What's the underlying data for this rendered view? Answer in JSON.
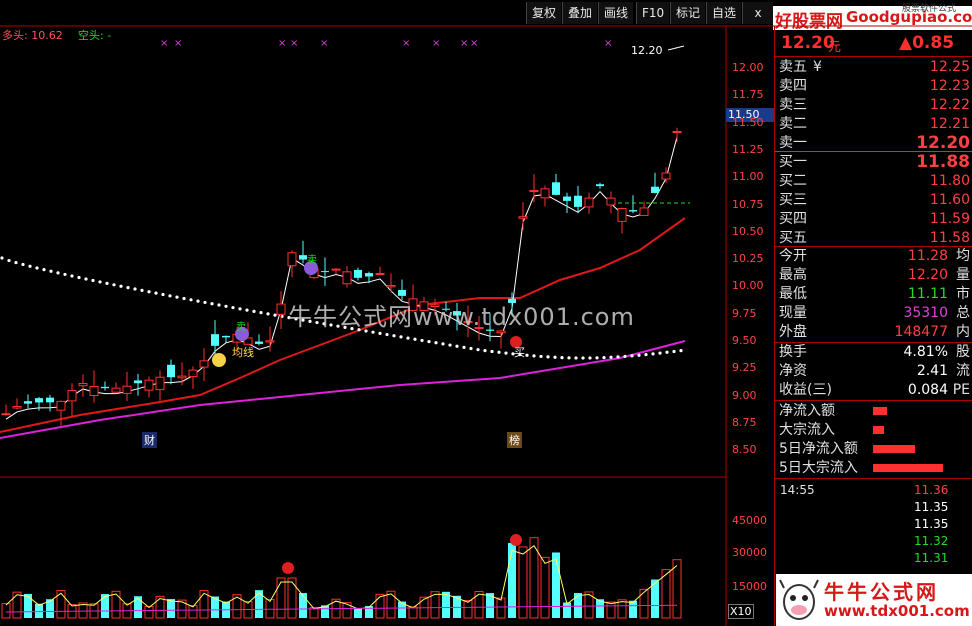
{
  "toolbar": {
    "buttons": [
      "复权",
      "叠加",
      "画线",
      "F10",
      "标记",
      "自选"
    ],
    "close_glyph": "x",
    "watermark_left": "好股票网",
    "watermark_right": "Goodgupiao.com",
    "watermark_small": "股票软件公式"
  },
  "indicator": {
    "bull_label": "多头: 10.62",
    "bear_label": "空头: -"
  },
  "chart": {
    "price_axis": [
      "12.00",
      "11.75",
      "11.50",
      "11.25",
      "11.00",
      "10.75",
      "10.50",
      "10.25",
      "10.00",
      "9.75",
      "9.50",
      "9.25",
      "9.00",
      "8.75",
      "8.50"
    ],
    "current_price_tag": "11.50",
    "high_label": "12.20",
    "watermark": "牛牛公式网www.tdx001.com",
    "mark_cai": "财",
    "mark_bang": "榜",
    "buy_label": "买",
    "sell_label": "卖",
    "sign_label": "卖",
    "chip_label": "均线",
    "volume_axis": [
      "45000",
      "30000",
      "15000"
    ],
    "volume_unit": "X10"
  },
  "quote": {
    "price": "12.20",
    "price_unit": "元",
    "change": "▲0.85",
    "asks": [
      {
        "label": "卖五",
        "value": "12.25",
        "extra": "¥"
      },
      {
        "label": "卖四",
        "value": "12.23"
      },
      {
        "label": "卖三",
        "value": "12.22"
      },
      {
        "label": "卖二",
        "value": "12.21"
      },
      {
        "label": "卖一",
        "value": "12.20"
      }
    ],
    "bids": [
      {
        "label": "买一",
        "value": "11.88"
      },
      {
        "label": "买二",
        "value": "11.80"
      },
      {
        "label": "买三",
        "value": "11.60"
      },
      {
        "label": "买四",
        "value": "11.59"
      },
      {
        "label": "买五",
        "value": "11.58"
      }
    ],
    "stats": [
      {
        "label": "今开",
        "value": "11.28",
        "right": "均"
      },
      {
        "label": "最高",
        "value": "12.20",
        "right": "量"
      },
      {
        "label": "最低",
        "value": "11.11",
        "right": "市"
      },
      {
        "label": "现量",
        "value": "35310",
        "right": "总"
      },
      {
        "label": "外盘",
        "value": "148477",
        "right": "内"
      }
    ],
    "fin": [
      {
        "label": "换手",
        "value": "4.81%",
        "right": "股"
      },
      {
        "label": "净资",
        "value": "2.41",
        "right": "流"
      },
      {
        "label": "收益(三)",
        "value": "0.084",
        "right": "PE"
      }
    ],
    "flows": [
      {
        "label": "净流入额",
        "bar": 0.2
      },
      {
        "label": "大宗流入",
        "bar": 0.16
      },
      {
        "label": "5日净流入额",
        "bar": 0.6
      },
      {
        "label": "5日大宗流入",
        "bar": 1.0
      }
    ],
    "ticks": [
      {
        "time": "14:55",
        "price": "11.36",
        "color": "#ff4040"
      },
      {
        "time": "",
        "price": "11.35",
        "color": "#ffffff"
      },
      {
        "time": "",
        "price": "11.35",
        "color": "#ffffff"
      },
      {
        "time": "",
        "price": "11.32",
        "color": "#22dd22"
      },
      {
        "time": "",
        "price": "11.31",
        "color": "#22dd22"
      }
    ]
  },
  "brand": {
    "name": "牛牛公式网",
    "url": "www.tdx001.com"
  }
}
